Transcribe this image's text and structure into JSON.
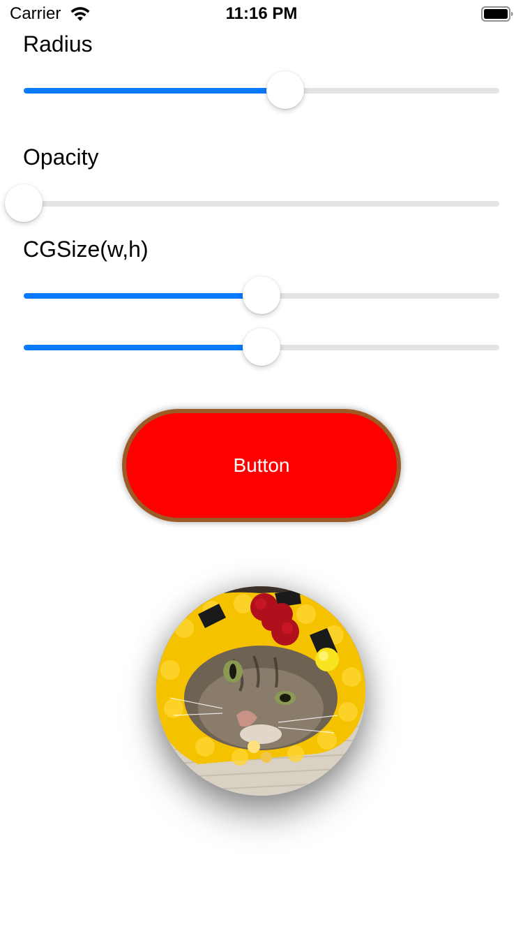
{
  "status_bar": {
    "carrier": "Carrier",
    "time": "11:16 PM",
    "wifi_icon": "wifi-icon",
    "battery_icon": "battery-icon"
  },
  "controls": {
    "radius_label": "Radius",
    "opacity_label": "Opacity",
    "cgsize_label": "CGSize(w,h)"
  },
  "sliders": {
    "radius": {
      "value": 0.55
    },
    "opacity": {
      "value": 0.0
    },
    "width": {
      "value": 0.5
    },
    "height": {
      "value": 0.5
    }
  },
  "button": {
    "label": "Button",
    "background": "#ff0000",
    "border_color": "#9b5a26",
    "text_color": "#ffffff"
  },
  "photo": {
    "icon": "cat-in-bee-hat-photo"
  },
  "colors": {
    "slider_fill": "#0a7aff",
    "slider_track": "#e3e3e3"
  }
}
